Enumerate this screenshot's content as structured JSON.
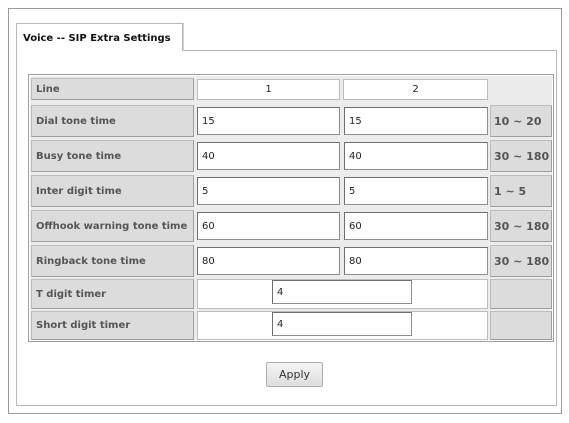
{
  "tab": {
    "title": "Voice -- SIP Extra Settings"
  },
  "table": {
    "line_label": "Line",
    "line_columns": [
      "1",
      "2"
    ],
    "rows": [
      {
        "label": "Dial tone time",
        "line1": "15",
        "line2": "15",
        "range": "10 ~ 20"
      },
      {
        "label": "Busy tone time",
        "line1": "40",
        "line2": "40",
        "range": "30 ~ 180"
      },
      {
        "label": "Inter digit time",
        "line1": "5",
        "line2": "5",
        "range": "1 ~ 5"
      },
      {
        "label": "Offhook warning tone time",
        "line1": "60",
        "line2": "60",
        "range": "30 ~ 180"
      },
      {
        "label": "Ringback tone time",
        "line1": "80",
        "line2": "80",
        "range": "30 ~ 180"
      }
    ],
    "shared_rows": [
      {
        "label": "T digit timer",
        "value": "4"
      },
      {
        "label": "Short digit timer",
        "value": "4"
      }
    ]
  },
  "actions": {
    "apply_label": "Apply"
  }
}
